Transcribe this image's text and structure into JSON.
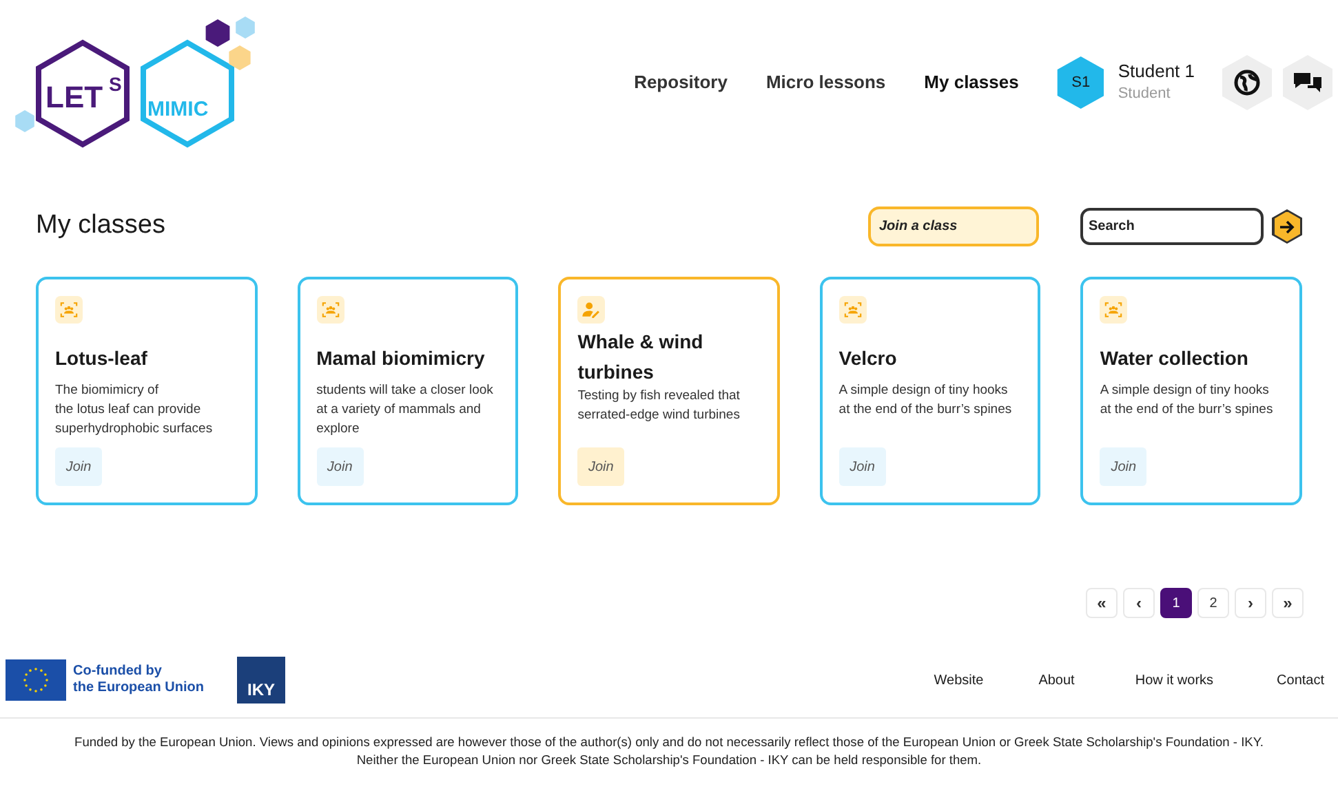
{
  "logo": {
    "word_1": "LET",
    "word_2": "S",
    "word_3": "MIMIC"
  },
  "nav": [
    {
      "label": "Repository",
      "selected": false
    },
    {
      "label": "Micro lessons",
      "selected": false
    },
    {
      "label": "My classes",
      "selected": true
    }
  ],
  "user": {
    "initials": "S1",
    "name": "Student 1",
    "role": "Student"
  },
  "page_title": "My classes",
  "join_field": {
    "placeholder": "Join a class"
  },
  "search": {
    "placeholder": "Search"
  },
  "classes": [
    {
      "kind": "group",
      "title": "Lotus-leaf",
      "description": "The biomimicry of\nthe lotus leaf can provide superhydrophobic surfaces",
      "button": "Join"
    },
    {
      "kind": "group",
      "title": "Mamal biomimicry",
      "description": "students will take a closer look at a variety of mammals and explore",
      "button": "Join"
    },
    {
      "kind": "teacher",
      "title": "Whale & wind turbines",
      "description": "Testing by fish  revealed that serrated-edge wind turbines",
      "button": "Join"
    },
    {
      "kind": "group",
      "title": "Velcro",
      "description": "A simple design of tiny hooks at the end of the burr’s spines",
      "button": "Join"
    },
    {
      "kind": "group",
      "title": "Water collection",
      "description": "A simple design of tiny hooks at the end of the burr’s spines",
      "button": "Join"
    }
  ],
  "pagination": [
    {
      "label": "«",
      "kind": "nav"
    },
    {
      "label": "‹",
      "kind": "nav"
    },
    {
      "label": "1",
      "kind": "page",
      "selected": true
    },
    {
      "label": "2",
      "kind": "page",
      "selected": false
    },
    {
      "label": "›",
      "kind": "nav"
    },
    {
      "label": "»",
      "kind": "nav"
    }
  ],
  "footer": {
    "eu_text": "Co-funded by\nthe European Union",
    "iky": "IKY",
    "links": [
      "Website",
      "About",
      "How it works",
      "Contact"
    ],
    "disclaimer": [
      "Funded by the European Union. Views and opinions expressed are however those of the author(s) only and do not necessarily reflect those of the European Union or Greek State Scholarship's Foundation - IKY.",
      "Neither the European Union nor Greek State Scholarship's Foundation - IKY can be held responsible for them."
    ]
  }
}
